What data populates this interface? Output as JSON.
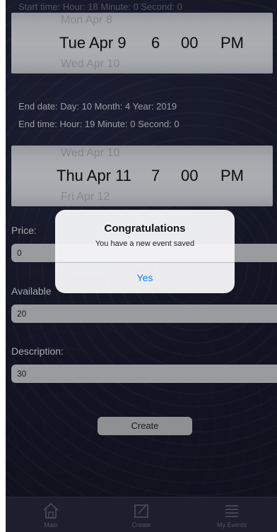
{
  "status_line": "Start time: Hour: 18 Minute: 0 Second: 0",
  "start_picker": {
    "above": "Mon Apr 8",
    "selected_date": "Tue Apr 9",
    "selected_hour": "6",
    "selected_minute": "00",
    "selected_ampm": "PM",
    "below": "Wed Apr 10"
  },
  "end_info": {
    "date": "End date:  Day: 10 Month: 4 Year: 2019",
    "time": "End time:  Hour: 19 Minute: 0 Second: 0"
  },
  "end_picker": {
    "above": "Wed Apr 10",
    "selected_date": "Thu Apr 11",
    "selected_hour": "7",
    "selected_minute": "00",
    "selected_ampm": "PM",
    "below": "Fri Apr 12"
  },
  "form": {
    "price_label": "Price:",
    "price_value": "0",
    "available_label": "Available",
    "available_value": "20",
    "description_label": "Description:",
    "description_value": "30",
    "create_label": "Create"
  },
  "tabs": [
    {
      "label": "Main",
      "icon": "home-icon"
    },
    {
      "label": "Create",
      "icon": "edit-icon"
    },
    {
      "label": "My Events",
      "icon": "list-icon"
    }
  ],
  "alert": {
    "title": "Congratulations",
    "message": "You have a new event saved",
    "button": "Yes"
  }
}
